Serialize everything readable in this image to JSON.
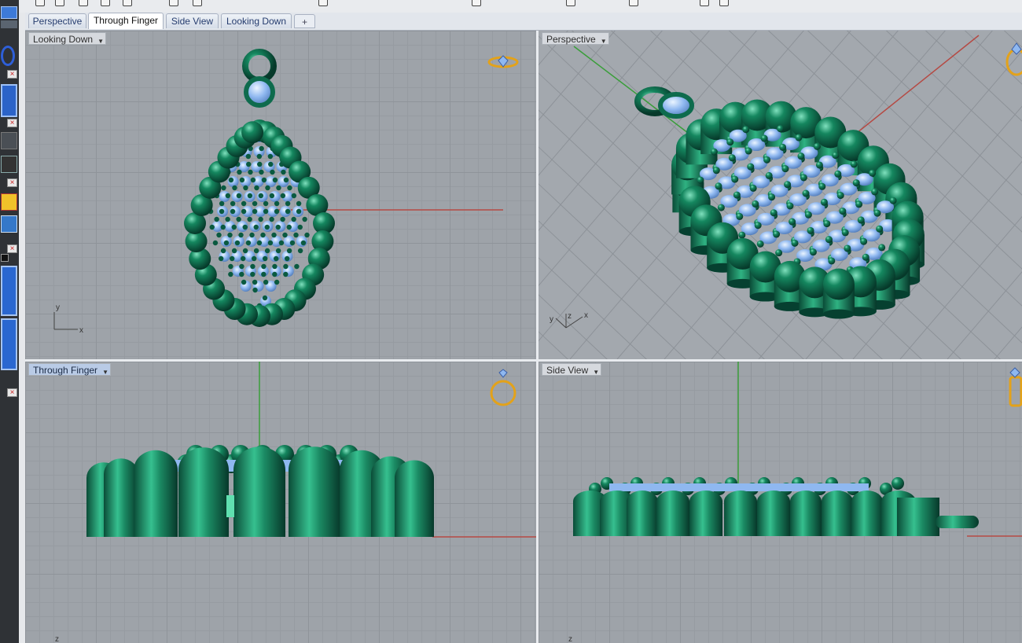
{
  "tabs": [
    {
      "label": "Perspective",
      "active": false
    },
    {
      "label": "Through Finger",
      "active": true
    },
    {
      "label": "Side View",
      "active": false
    },
    {
      "label": "Looking Down",
      "active": false
    }
  ],
  "tab_add_icon": "+",
  "viewports": {
    "top_left": {
      "title": "Looking Down",
      "active": false,
      "axis_y": "y",
      "axis_x": "x",
      "icon": "ring-top-icon"
    },
    "top_right": {
      "title": "Perspective",
      "active": false,
      "axis_y": "y",
      "axis_z": "z",
      "axis_x": "x",
      "icon": "ring-perspective-icon"
    },
    "bottom_left": {
      "title": "Through Finger",
      "active": true,
      "axis_z": "z",
      "icon": "ring-front-icon"
    },
    "bottom_right": {
      "title": "Side View",
      "active": false,
      "axis_z": "z",
      "icon": "ring-side-icon"
    }
  },
  "colors": {
    "gem_green": "#0e6b4d",
    "stone_blue": "#8fb8f0",
    "axis_red": "#b54a44",
    "axis_green": "#3a9e3a",
    "ring_gold": "#e3a21a",
    "viewport_bg": "#9ea3a9"
  },
  "dropdown_arrow": "▼",
  "close_glyph": "×"
}
